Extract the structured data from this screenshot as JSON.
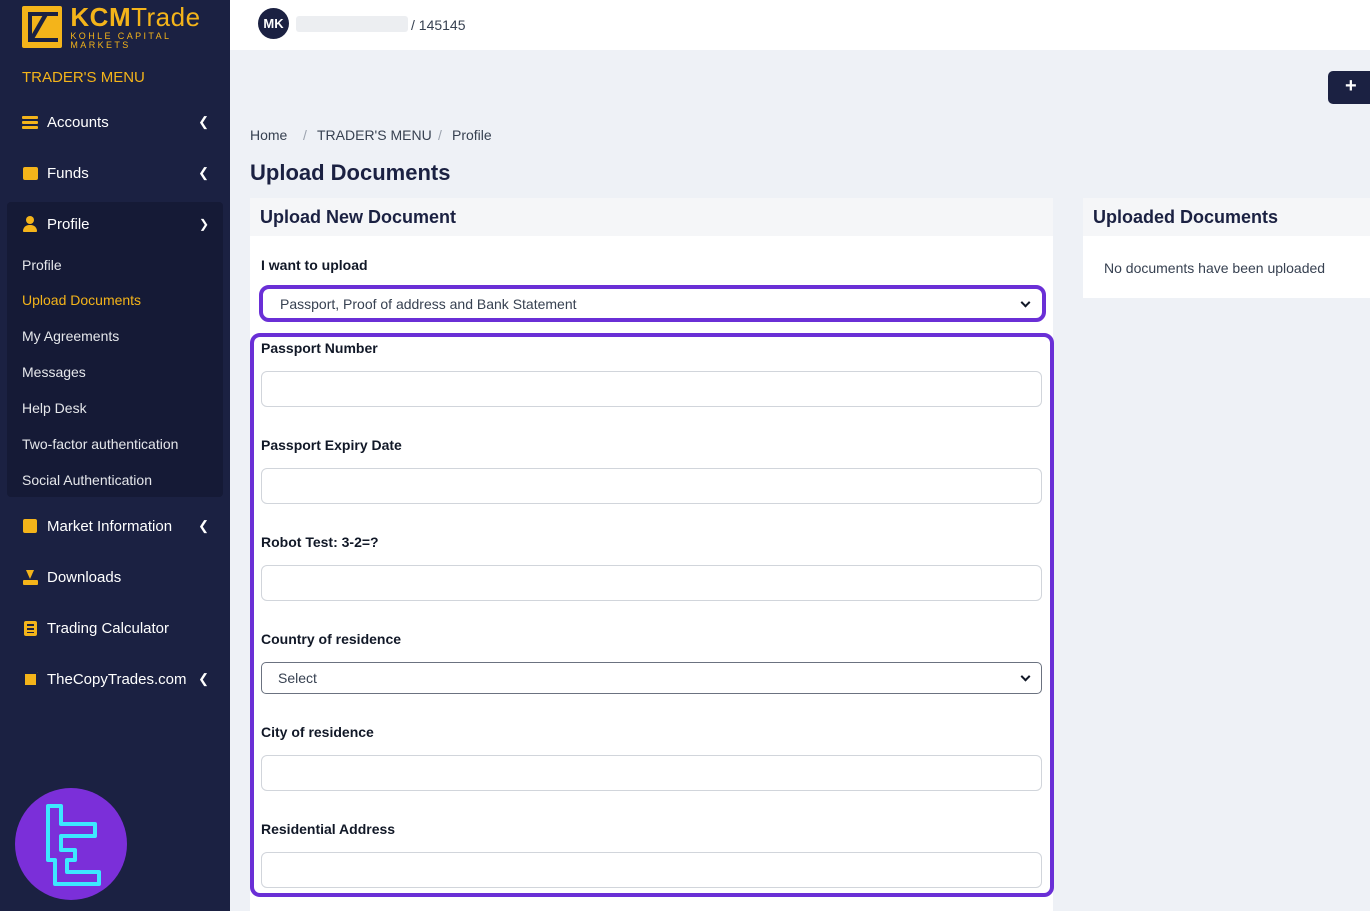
{
  "brand": {
    "name_bold": "KCM",
    "name_light": "Trade",
    "tagline": "KOHLE CAPITAL MARKETS",
    "accent": "#f4b41a",
    "sidebar_bg": "#1b2142",
    "highlight": "#6a2fd6"
  },
  "sidebar": {
    "menu_title": "TRADER'S MENU",
    "items": [
      {
        "label": "Accounts",
        "icon": "list-icon"
      },
      {
        "label": "Funds",
        "icon": "wallet-icon"
      },
      {
        "label": "Profile",
        "icon": "user-icon"
      },
      {
        "label": "Market Information",
        "icon": "calendar-icon"
      },
      {
        "label": "Downloads",
        "icon": "download-icon"
      },
      {
        "label": "Trading Calculator",
        "icon": "calculator-icon"
      },
      {
        "label": "TheCopyTrades.com",
        "icon": "copy-icon"
      }
    ],
    "profile_sub": [
      "Profile",
      "Upload Documents",
      "My Agreements",
      "Messages",
      "Help Desk",
      "Two-factor authentication",
      "Social Authentication"
    ]
  },
  "topbar": {
    "avatar_initials": "MK",
    "account_id": "/ 145145",
    "add_button": "+"
  },
  "breadcrumb": [
    "Home",
    "TRADER'S MENU",
    "Profile"
  ],
  "page_title": "Upload Documents",
  "upload_card": {
    "title": "Upload New Document",
    "want_label": "I want to upload",
    "want_value": "Passport, Proof of address and Bank Statement",
    "fields": {
      "passport_number": "Passport Number",
      "passport_expiry": "Passport Expiry Date",
      "robot_test": "Robot Test: 3-2=?",
      "country": "Country of residence",
      "country_value": "Select",
      "city": "City of residence",
      "address": "Residential Address"
    }
  },
  "uploaded_card": {
    "title": "Uploaded Documents",
    "empty_text": "No documents have been uploaded"
  }
}
